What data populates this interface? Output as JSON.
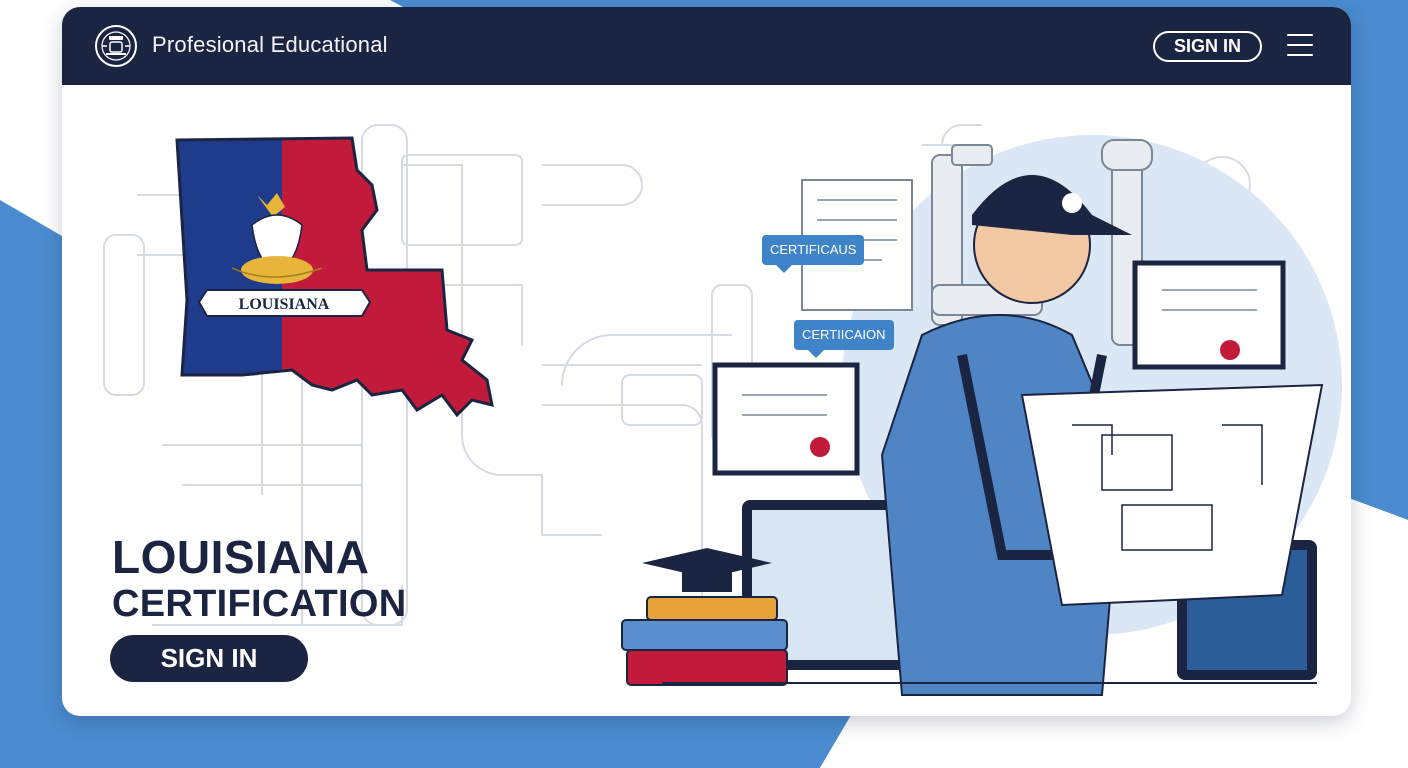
{
  "header": {
    "brand": "Profesional Educational",
    "signin_label": "SIGN IN"
  },
  "hero": {
    "title": "LOUISIANA",
    "subtitle": "CERTIFICATION",
    "signin_label": "SIGN IN",
    "banner_text": "LOUISIANA"
  },
  "illustration": {
    "bubble_1": "CERTIFICAUS",
    "bubble_2": "CERTIICAION"
  },
  "colors": {
    "navy": "#1b2440",
    "accent_blue": "#3f84c9",
    "flag_blue": "#1f3b8c",
    "flag_red": "#c11a3a",
    "background_blue": "#4a8ccf"
  },
  "icons": [
    "logo-emblem-icon",
    "menu-icon"
  ]
}
